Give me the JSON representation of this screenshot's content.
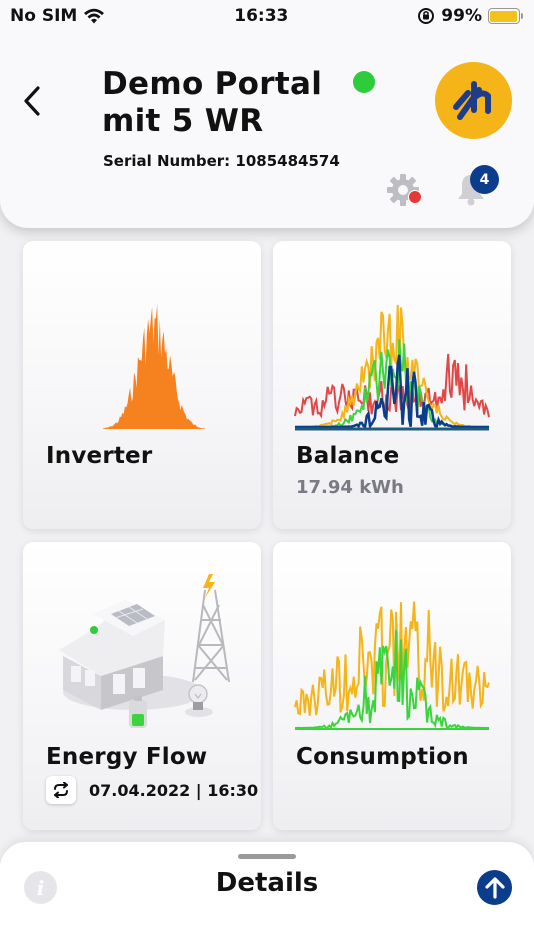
{
  "status_bar": {
    "carrier": "No SIM",
    "time": "16:33",
    "battery": "99%",
    "battery_level": 0.99,
    "icons": [
      "wifi-icon",
      "orientation-lock-icon",
      "battery-icon"
    ]
  },
  "header": {
    "title": "Demo Portal mit 5 WR",
    "serial_label": "Serial Number: 1085484574",
    "notification_count": "4",
    "colors": {
      "online": "#2ecc3b",
      "logo": "#f5b417",
      "badge": "#0b3d8c",
      "alert": "#e53935"
    }
  },
  "tiles": {
    "inverter": {
      "title": "Inverter",
      "color": "#f5821f"
    },
    "balance": {
      "title": "Balance",
      "value": "17.94 kWh",
      "colors": [
        "#e04848",
        "#f5b417",
        "#3cd43c",
        "#0b3d8c"
      ]
    },
    "energy_flow": {
      "title": "Energy Flow",
      "datetime": "07.04.2022 | 16:30"
    },
    "consumption": {
      "title": "Consumption",
      "colors": [
        "#f5b417",
        "#3cd43c"
      ]
    }
  },
  "bottom_sheet": {
    "label": "Details"
  }
}
